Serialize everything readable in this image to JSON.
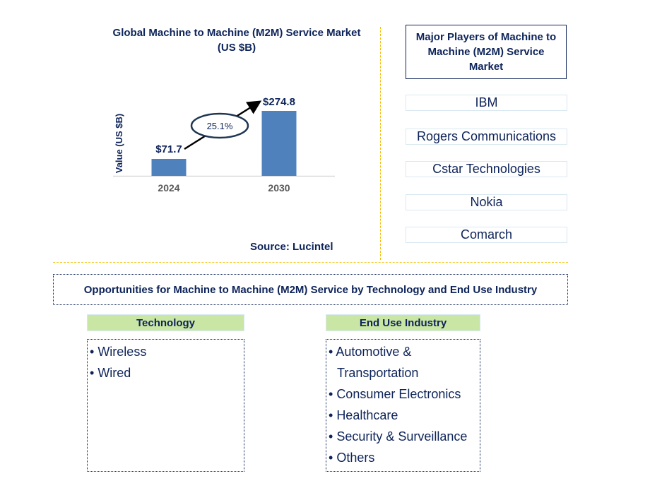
{
  "chart_data": {
    "type": "bar",
    "title": "Global Machine to Machine (M2M) Service Market (US $B)",
    "xlabel": "",
    "ylabel": "Value (US $B)",
    "categories": [
      "2024",
      "2030"
    ],
    "values": [
      71.7,
      274.8
    ],
    "data_labels": [
      "$71.7",
      "$274.8"
    ],
    "annotation": {
      "label": "25.1%",
      "meaning": "CAGR 2024-2030",
      "shape": "ellipse-with-arrow"
    },
    "ylim": [
      0,
      300
    ],
    "grid": false,
    "legend": "none",
    "bar_color": "#4f81bd",
    "source": "Source: Lucintel"
  },
  "players": {
    "title": "Major Players of Machine to Machine (M2M) Service Market",
    "items": [
      "IBM",
      "Rogers Communications",
      "Cstar Technologies",
      "Nokia",
      "Comarch"
    ]
  },
  "opportunities": {
    "banner": "Opportunities for Machine to Machine (M2M) Service by Technology and End Use Industry",
    "segments": [
      {
        "heading": "Technology",
        "items": [
          "Wireless",
          "Wired"
        ]
      },
      {
        "heading": "End Use Industry",
        "items": [
          "Automotive & Transportation",
          "Consumer Electronics",
          "Healthcare",
          "Security & Surveillance",
          "Others"
        ]
      }
    ]
  },
  "colors": {
    "text": "#0d2359",
    "bar": "#4f81bd",
    "divider": "#f5b800",
    "segment_header": "#c9e6a5",
    "player_border": "#d9e8f2"
  }
}
